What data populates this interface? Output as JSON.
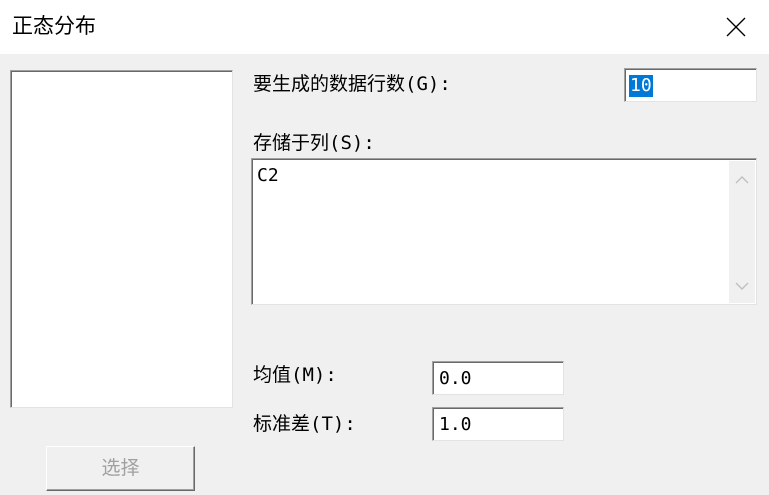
{
  "window": {
    "title": "正态分布",
    "close_icon": "close-icon"
  },
  "form": {
    "rows_label": "要生成的数据行数(G):",
    "rows_value": "10",
    "store_label": "存储于列(S):",
    "store_value": "C2",
    "mean_label": "均值(M):",
    "mean_value": "0.0",
    "std_label": "标准差(T):",
    "std_value": "1.0"
  },
  "buttons": {
    "select_label": "选择"
  },
  "colors": {
    "selection": "#0078d7",
    "disabled_text": "#a0a0a0"
  }
}
